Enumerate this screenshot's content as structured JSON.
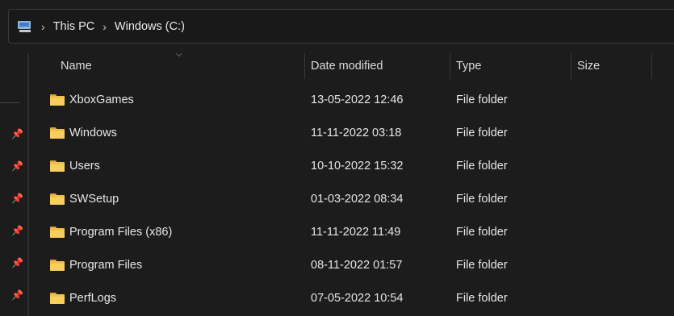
{
  "breadcrumb": [
    "This PC",
    "Windows (C:)"
  ],
  "icons": {
    "location": "pc-icon",
    "folder": "folder-icon",
    "pin": "pin-icon",
    "sort": "chevron-down-icon"
  },
  "columns": {
    "name": "Name",
    "date": "Date modified",
    "type": "Type",
    "size": "Size"
  },
  "rows": [
    {
      "name": "XboxGames",
      "date": "13-05-2022 12:46",
      "type": "File folder",
      "size": ""
    },
    {
      "name": "Windows",
      "date": "11-11-2022 03:18",
      "type": "File folder",
      "size": ""
    },
    {
      "name": "Users",
      "date": "10-10-2022 15:32",
      "type": "File folder",
      "size": ""
    },
    {
      "name": "SWSetup",
      "date": "01-03-2022 08:34",
      "type": "File folder",
      "size": ""
    },
    {
      "name": "Program Files (x86)",
      "date": "11-11-2022 11:49",
      "type": "File folder",
      "size": ""
    },
    {
      "name": "Program Files",
      "date": "08-11-2022 01:57",
      "type": "File folder",
      "size": ""
    },
    {
      "name": "PerfLogs",
      "date": "07-05-2022 10:54",
      "type": "File folder",
      "size": ""
    }
  ]
}
